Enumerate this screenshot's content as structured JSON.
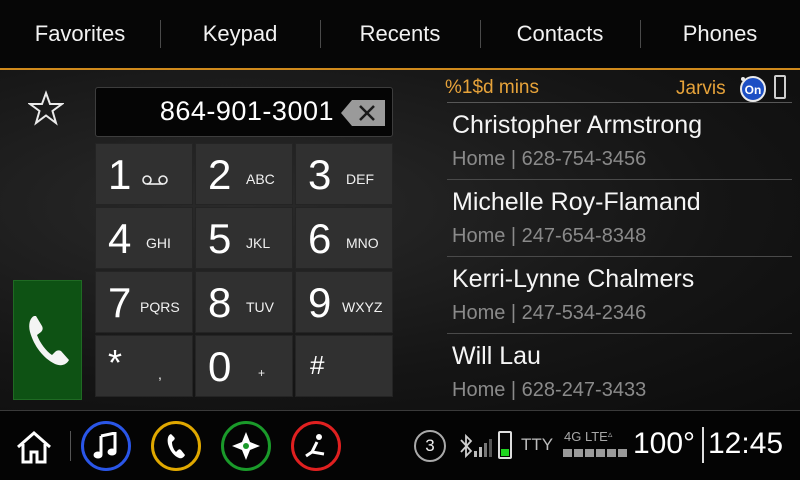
{
  "tabs": [
    {
      "label": "Favorites"
    },
    {
      "label": "Keypad"
    },
    {
      "label": "Recents"
    },
    {
      "label": "Contacts"
    },
    {
      "label": "Phones"
    }
  ],
  "dialer": {
    "number": "864-901-3001",
    "keys": [
      {
        "digit": "1",
        "letters": "",
        "icon": "voicemail-icon"
      },
      {
        "digit": "2",
        "letters": "ABC"
      },
      {
        "digit": "3",
        "letters": "DEF"
      },
      {
        "digit": "4",
        "letters": "GHI"
      },
      {
        "digit": "5",
        "letters": "JKL"
      },
      {
        "digit": "6",
        "letters": "MNO"
      },
      {
        "digit": "7",
        "letters": "PQRS"
      },
      {
        "digit": "8",
        "letters": "TUV"
      },
      {
        "digit": "9",
        "letters": "WXYZ"
      },
      {
        "digit": "*",
        "letters": ","
      },
      {
        "digit": "0",
        "letters": "+"
      },
      {
        "digit": "#",
        "letters": ""
      }
    ]
  },
  "status_panel": {
    "minutes": "%1$d mins",
    "assistant": "Jarvis"
  },
  "contacts": [
    {
      "name": "Christopher Armstrong",
      "detail": "Home | 628-754-3456"
    },
    {
      "name": "Michelle Roy-Flamand",
      "detail": "Home | 247-654-8348"
    },
    {
      "name": "Kerri-Lynne Chalmers",
      "detail": "Home | 247-534-2346"
    },
    {
      "name": "Will Lau",
      "detail": "Home | 628-247-3433"
    }
  ],
  "bottom_bar": {
    "notification_count": "3",
    "tty": "TTY",
    "network": "4G LTE",
    "temperature": "100°",
    "time": "12:45",
    "app_colors": {
      "music": "#2a56e8",
      "phone": "#e0a800",
      "nav": "#1a9a2a",
      "climate": "#e02020"
    },
    "battery_level": 0.3
  },
  "colors": {
    "accent": "#d08a1c",
    "status_text": "#e7a33a",
    "call_button": "#0e5214"
  }
}
